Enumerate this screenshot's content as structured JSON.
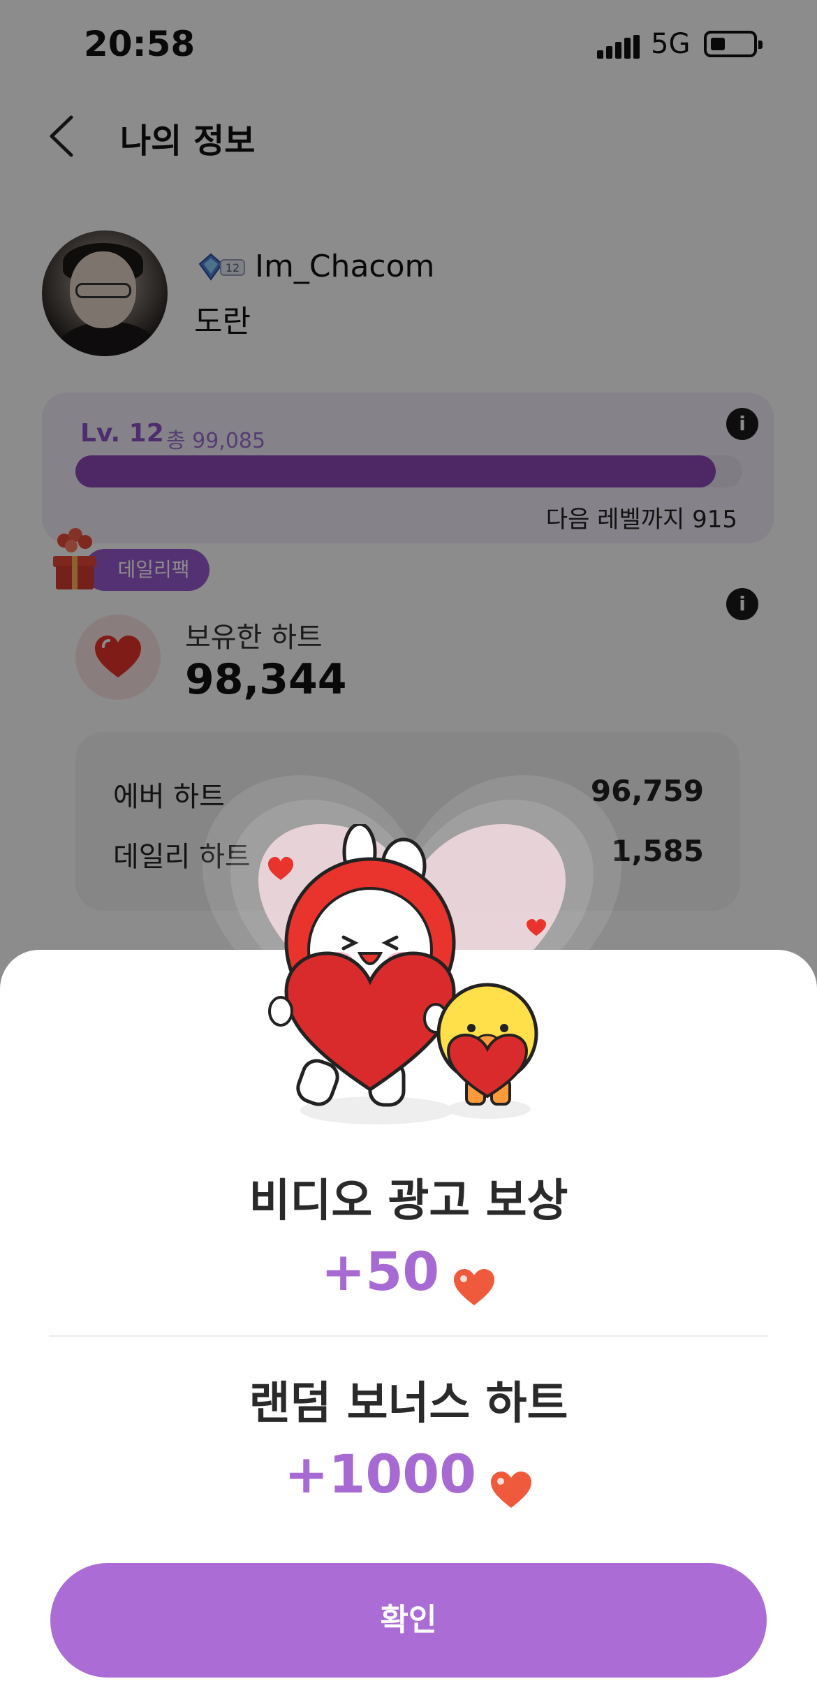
{
  "status_bar": {
    "time": "20:58",
    "network": "5G"
  },
  "header": {
    "title": "나의 정보"
  },
  "profile": {
    "username": "Im_Chacom",
    "nickname": "도란",
    "rank_level": "12"
  },
  "level": {
    "label": "Lv. 12",
    "total": "총 99,085",
    "progress": 0.96,
    "next": "다음 레벨까지 915",
    "info_icon": "i"
  },
  "hearts": {
    "daily_pack_label": "데일리팩",
    "info_icon": "i",
    "owned_label": "보유한 하트",
    "owned_value": "98,344",
    "rows": [
      {
        "label": "에버 하트",
        "value": "96,759"
      },
      {
        "label": "데일리 하트",
        "value": "1,585"
      }
    ]
  },
  "reward_sheet": {
    "video_title": "비디오 광고 보상",
    "video_amount": "+50",
    "bonus_title": "랜덤 보너스 하트",
    "bonus_amount": "+1000",
    "confirm_label": "확인"
  },
  "colors": {
    "accent": "#ab6cd6",
    "amount": "#a66ad2",
    "heart": "#ea4b3c"
  }
}
